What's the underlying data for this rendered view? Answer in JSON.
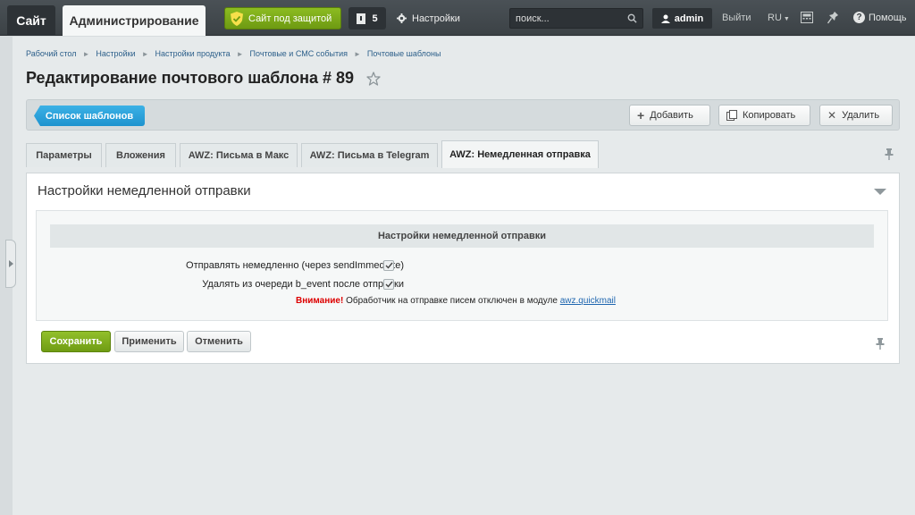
{
  "topbar": {
    "site_tab": "Сайт",
    "admin_tab": "Администрирование",
    "protect_label": "Сайт под защитой",
    "notifications_count": "5",
    "settings_label": "Настройки",
    "search_placeholder": "поиск...",
    "user_label": "admin",
    "logout_label": "Выйти",
    "lang_label": "RU",
    "help_label": "Помощь"
  },
  "breadcrumb": {
    "items": [
      "Рабочий стол",
      "Настройки",
      "Настройки продукта",
      "Почтовые и СМС события",
      "Почтовые шаблоны"
    ]
  },
  "page": {
    "title": "Редактирование почтового шаблона # 89"
  },
  "toolbar": {
    "list_label": "Список шаблонов",
    "add_label": "Добавить",
    "copy_label": "Копировать",
    "delete_label": "Удалить"
  },
  "tabs": [
    {
      "label": "Параметры"
    },
    {
      "label": "Вложения"
    },
    {
      "label": "AWZ: Письма в Макс"
    },
    {
      "label": "AWZ: Письма в Telegram"
    },
    {
      "label": "AWZ: Немедленная отправка"
    }
  ],
  "panel": {
    "title": "Настройки немедленной отправки",
    "section_title": "Настройки немедленной отправки",
    "field1_label": "Отправлять немедленно (через sendImmediate)",
    "field1_checked": true,
    "field2_label": "Удалять из очереди b_event после отправки",
    "field2_checked": true,
    "warning_strong": "Внимание!",
    "warning_text": " Обработчик на отправке писем отключен в модуле ",
    "warning_link": "awz.quickmail"
  },
  "buttons": {
    "save": "Сохранить",
    "apply": "Применить",
    "cancel": "Отменить"
  },
  "colors": {
    "accent_green": "#7aa818",
    "accent_blue": "#2aa0d9",
    "topbar": "#42494d",
    "warning_red": "#dd0000"
  }
}
